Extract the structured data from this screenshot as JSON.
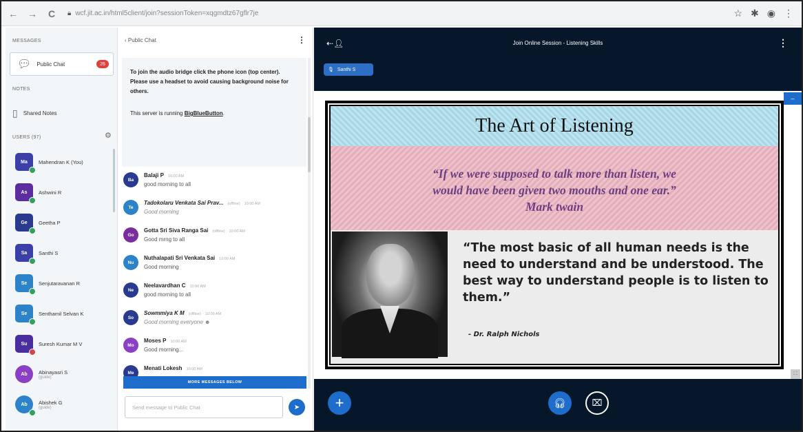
{
  "browser": {
    "url": "wcf.jit.ac.in/html5client/join?sessionToken=xqgmdtz67gflr7je",
    "back": "←",
    "forward": "→",
    "reload": "C"
  },
  "sidebar": {
    "messages_title": "MESSAGES",
    "public_chat_label": "Public Chat",
    "public_chat_badge": "26",
    "notes_title": "NOTES",
    "shared_notes_label": "Shared Notes",
    "users_title": "USERS (97)",
    "users": [
      {
        "initials": "Ma",
        "name": "Mahendran K (You)",
        "color": "#3b3fa8",
        "dot": "#2ea35a",
        "status": ""
      },
      {
        "initials": "As",
        "name": "Ashwini R",
        "color": "#5b2d9e",
        "dot": "#2ea35a",
        "status": ""
      },
      {
        "initials": "Ge",
        "name": "Geetha P",
        "color": "#2a3b8f",
        "dot": "#2ea35a",
        "status": ""
      },
      {
        "initials": "Sa",
        "name": "Santhi S",
        "color": "#3b3fa8",
        "dot": "#2ea35a",
        "status": ""
      },
      {
        "initials": "Se",
        "name": "Senjutaravanan R",
        "color": "#2c83c9",
        "dot": "#2ea35a",
        "status": ""
      },
      {
        "initials": "Se",
        "name": "Senthamil Selvan K",
        "color": "#2c83c9",
        "dot": "#2ea35a",
        "status": ""
      },
      {
        "initials": "Su",
        "name": "Suresh Kumar M V",
        "color": "#4a2d9e",
        "dot": "#d9434a",
        "status": ""
      },
      {
        "initials": "Ab",
        "name": "Abinayasri S",
        "color": "#8a3fc4",
        "dot": "",
        "status": "(guide)"
      },
      {
        "initials": "Ab",
        "name": "Abishek G",
        "color": "#2c83c9",
        "dot": "#2ea35a",
        "status": "(guide)"
      }
    ]
  },
  "chat": {
    "header": "‹  Public Chat",
    "welcome_part1": "To join the audio bridge click the phone icon (top center). Please use a headset to avoid causing background noise for others.",
    "welcome_part2_prefix": "This server is running ",
    "welcome_part2_link": "BigBlueButton",
    "welcome_part2_suffix": ".",
    "messages": [
      {
        "initials": "Ba",
        "name": "Balaji P",
        "time": "10:00 AM",
        "text": "good morning to all",
        "color": "#2a3b8f",
        "italic": false,
        "offline": ""
      },
      {
        "initials": "Te",
        "name": "Tadokolaru Venkata Sai Prav...",
        "time": "10:00 AM",
        "text": "Good morning",
        "color": "#2c83c9",
        "italic": true,
        "offline": "(offline)"
      },
      {
        "initials": "Go",
        "name": "Gotta Sri Siva Ranga Sai",
        "time": "10:00 AM",
        "text": "Good mrng to all",
        "color": "#7a2d9e",
        "italic": false,
        "offline": "(offline)"
      },
      {
        "initials": "Nu",
        "name": "Nuthalapati Sri Venkata Sai",
        "time": "10:00 AM",
        "text": "Good morning",
        "color": "#2c83c9",
        "italic": false,
        "offline": ""
      },
      {
        "initials": "Ne",
        "name": "Neelavardhan C",
        "time": "10:00 AM",
        "text": "good morning to all",
        "color": "#2a3b8f",
        "italic": false,
        "offline": ""
      },
      {
        "initials": "So",
        "name": "Sowmmiya K M",
        "time": "10:00 AM",
        "text": "Good morning everyone ☻",
        "color": "#2a3b8f",
        "italic": true,
        "offline": "(offline)"
      },
      {
        "initials": "Mo",
        "name": "Moses P",
        "time": "10:00 AM",
        "text": "Good morning...",
        "color": "#8a3fc4",
        "italic": false,
        "offline": ""
      },
      {
        "initials": "Me",
        "name": "Menati Lokesh",
        "time": "10:00 AM",
        "text": "",
        "color": "#2a3b8f",
        "italic": false,
        "offline": ""
      }
    ],
    "more_messages": "MORE MESSAGES BELOW",
    "input_placeholder": "Send message to Public Chat",
    "send_icon": "send-icon"
  },
  "main": {
    "session_title": "Join Online Session - Listening Skills",
    "talking_user": "Santhi S",
    "slide": {
      "title": "The Art of Listening",
      "quote_line1": "“If we were supposed to talk more than listen, we",
      "quote_line2": "would have been given two mouths and one ear.”",
      "quote_author": "Mark twain",
      "big_quote": "“The most basic of all human needs is the need to understand and be understood. The best way to understand people is to listen to them.”",
      "attribution": "- Dr. Ralph Nichols"
    },
    "colors": {
      "accent": "#1e6ccc",
      "bg": "#06172a",
      "badge": "#e0403c"
    }
  }
}
